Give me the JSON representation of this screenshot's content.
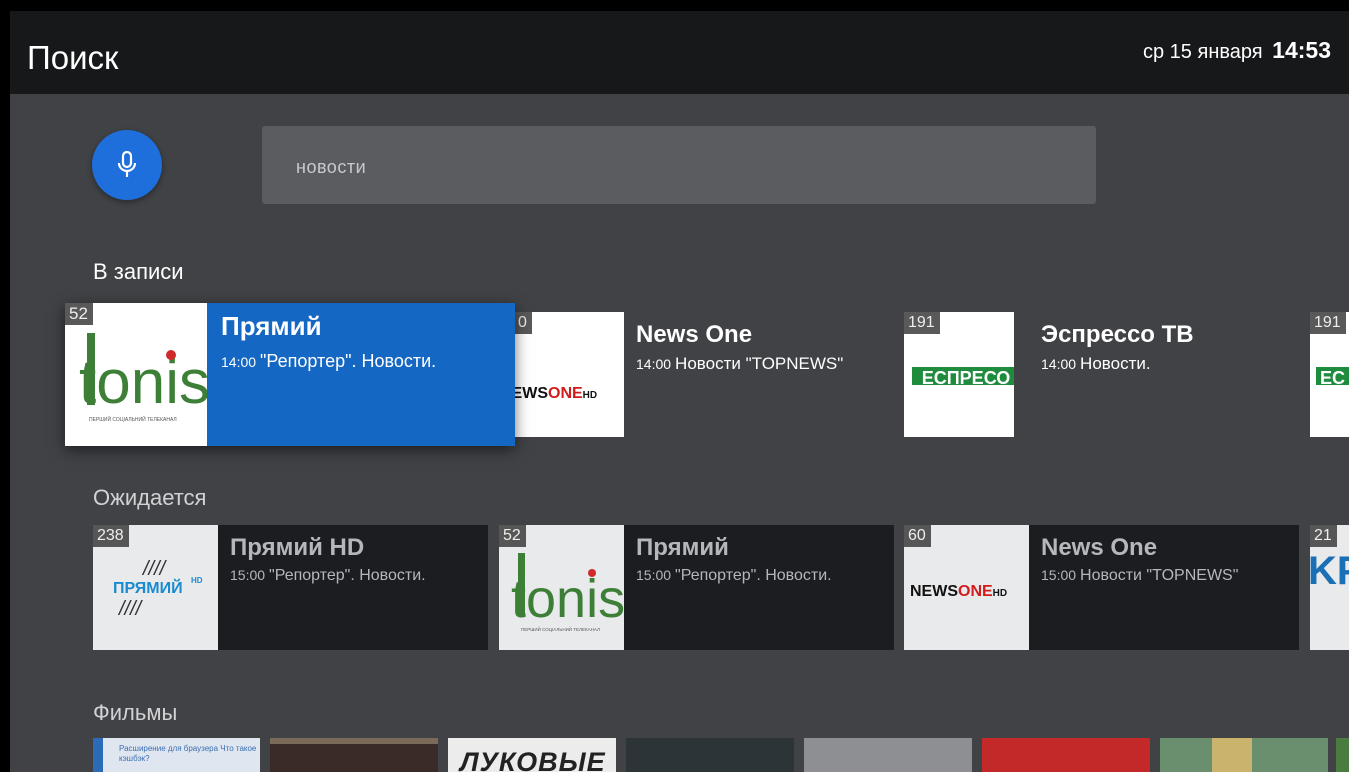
{
  "header": {
    "title": "Поиск",
    "date": "ср 15 января",
    "time": "14:53"
  },
  "search": {
    "value": "новости"
  },
  "sections": {
    "recorded": "В записи",
    "expected": "Ожидается",
    "films": "Фильмы"
  },
  "recorded": [
    {
      "num": "52",
      "title": "Прямий",
      "time": "14:00",
      "desc": "\"Репортер\". Новости."
    },
    {
      "num": "0",
      "title": "News One",
      "time": "14:00",
      "desc": "Новости \"TOPNEWS\""
    },
    {
      "num": "191",
      "title": "Эспрессо ТВ",
      "time": "14:00",
      "desc": "Новости."
    },
    {
      "num": "191"
    }
  ],
  "expected": [
    {
      "num": "238",
      "title": "Прямий HD",
      "time": "15:00",
      "desc": "\"Репортер\". Новости."
    },
    {
      "num": "52",
      "title": "Прямий",
      "time": "15:00",
      "desc": "\"Репортер\". Новости."
    },
    {
      "num": "60",
      "title": "News One",
      "time": "15:00",
      "desc": "Новости \"TOPNEWS\""
    },
    {
      "num": "21"
    }
  ],
  "logos": {
    "tonis": "tonis",
    "tonis_sub": "ПЕРШИЙ СОЦІАЛЬНИЙ ТЕЛЕКАНАЛ",
    "newsone_a": "NEWS",
    "newsone_b": "ONE",
    "newsone_hd": "HD",
    "espreso": "ЕСПРЕСО",
    "pryamiy": "ПРЯМИЙ",
    "pryamiy_hd": "HD",
    "cut_espreso": "ЕС",
    "cut_kr": "KP"
  },
  "films": [
    {
      "text": "Расширение для браузера   Что такое кэшбэк?"
    },
    {
      "text": ""
    },
    {
      "text": "ЛУКОВЫЕ"
    },
    {
      "text": ""
    },
    {
      "text": ""
    },
    {
      "text": ""
    },
    {
      "text": ""
    }
  ]
}
